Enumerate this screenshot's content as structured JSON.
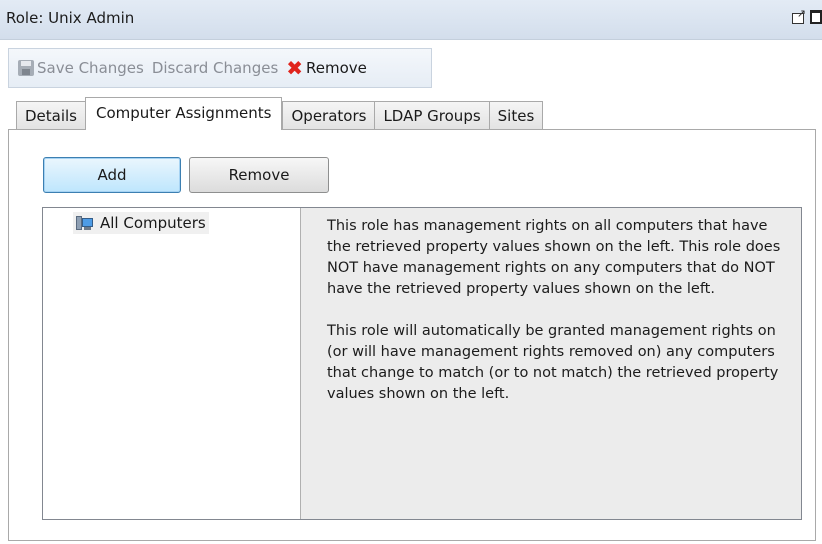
{
  "titlebar": {
    "title": "Role: Unix Admin"
  },
  "toolbar": {
    "save_label": "Save Changes",
    "discard_label": "Discard Changes",
    "remove_label": "Remove"
  },
  "tabs": [
    {
      "label": "Details",
      "active": false
    },
    {
      "label": "Computer Assignments",
      "active": true
    },
    {
      "label": "Operators",
      "active": false
    },
    {
      "label": "LDAP Groups",
      "active": false
    },
    {
      "label": "Sites",
      "active": false
    }
  ],
  "panel": {
    "add_label": "Add",
    "remove_label": "Remove",
    "tree_item": "All Computers",
    "info_paragraphs": [
      "This role has management rights on all computers that have the retrieved property values shown on the left. This role does NOT have management rights on any computers that do NOT have the retrieved property values shown on the left.",
      "This role will automatically be granted management rights on (or will have management rights removed on) any computers that change to match (or to not match) the retrieved property values shown on the left."
    ]
  },
  "icons": {
    "save": "save-icon",
    "remove": "x-icon",
    "tree": "computers-icon",
    "popout": "popout-icon",
    "maximize": "maximize-icon"
  },
  "colors": {
    "remove_accent": "#e0241c",
    "titlebar": "#dbe4f0",
    "info_bg": "#ececec"
  }
}
